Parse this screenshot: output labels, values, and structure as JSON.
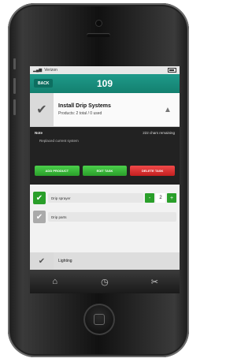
{
  "status": {
    "carrier": "Verizon",
    "time": "",
    "battery_icon": "battery-icon"
  },
  "nav": {
    "back_label": "BACK",
    "title": "109"
  },
  "task": {
    "title": "Install Drip Systems",
    "subtitle": "Products: 2 total / 0 used",
    "check_icon": "checkmark-icon",
    "caret_icon": "triangle-up-icon"
  },
  "note": {
    "label": "Note",
    "remaining": "222 chars remaining",
    "text": "Replaced current system"
  },
  "actions": [
    {
      "label": "ADD PRODUCT"
    },
    {
      "label": "EDIT TASK"
    },
    {
      "label": "DELETE TASK"
    }
  ],
  "parts": [
    {
      "name": "Drip sprayer",
      "qty": "2",
      "minus": "-",
      "plus": "+"
    },
    {
      "name": "Drip parts"
    }
  ],
  "bottom_item": {
    "title": "Lighting"
  },
  "tabs": [
    {
      "icon": "home-icon"
    },
    {
      "icon": "clock-icon"
    },
    {
      "icon": "tools-icon"
    }
  ],
  "colors": {
    "nav": "#13806f",
    "green": "#2a9f2a",
    "red": "#c41f1f"
  }
}
